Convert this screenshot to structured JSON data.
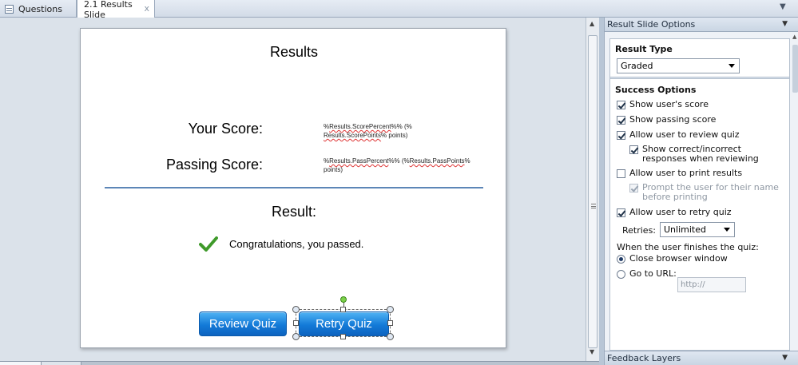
{
  "tabs": [
    {
      "label": "Questions",
      "active": false
    },
    {
      "label": "2.1 Results Slide",
      "active": true
    }
  ],
  "tab_close_glyph": "x",
  "slide": {
    "title": "Results",
    "score_label": "Your Score:",
    "score_var_line1_prefix": "%",
    "score_var_line1_token": "Results.ScorePercent",
    "score_var_line1_suffix": "%% (%",
    "score_var_line2_token": "Results.ScorePoints",
    "score_var_line2_suffix": "% points)",
    "pass_label": "Passing Score:",
    "pass_var_line1_prefix": "%",
    "pass_var_line1_token": "Results.PassPercent",
    "pass_var_line1_mid": "%% (%",
    "pass_var_line1_token2": "Results.PassPoints",
    "pass_var_line1_suffix": "%",
    "pass_var_line2": "points)",
    "result_label": "Result:",
    "message": "Congratulations, you passed.",
    "review_button": "Review Quiz",
    "retry_button": "Retry Quiz"
  },
  "panel": {
    "title": "Result Slide Options",
    "result_type_heading": "Result Type",
    "result_type_value": "Graded",
    "success_heading": "Success Options",
    "options": [
      {
        "label": "Show user's score",
        "checked": true,
        "enabled": true
      },
      {
        "label": "Show passing score",
        "checked": true,
        "enabled": true
      },
      {
        "label": "Allow user to review quiz",
        "checked": true,
        "enabled": true
      },
      {
        "label": "Show correct/incorrect responses when reviewing",
        "checked": true,
        "enabled": true,
        "sub": true
      },
      {
        "label": "Allow user to print results",
        "checked": false,
        "enabled": true
      },
      {
        "label": "Prompt the user for their name before printing",
        "checked": true,
        "enabled": false,
        "sub": true
      },
      {
        "label": "Allow user to retry quiz",
        "checked": true,
        "enabled": true
      }
    ],
    "retries_label": "Retries:",
    "retries_value": "Unlimited",
    "finish_label": "When the user finishes the quiz:",
    "finish_options": [
      {
        "label": "Close browser window",
        "selected": true
      },
      {
        "label": "Go to URL:",
        "selected": false
      }
    ],
    "url_placeholder": "http://",
    "footer_title": "Feedback Layers"
  },
  "colors": {
    "button_blue": "#137ad8",
    "divider": "#5c86b7",
    "check_green": "#3f9a2a"
  },
  "icons": [
    "questions-tab-icon",
    "close-icon",
    "chevron-down-icon",
    "checkmark-icon",
    "rotate-handle-icon"
  ]
}
